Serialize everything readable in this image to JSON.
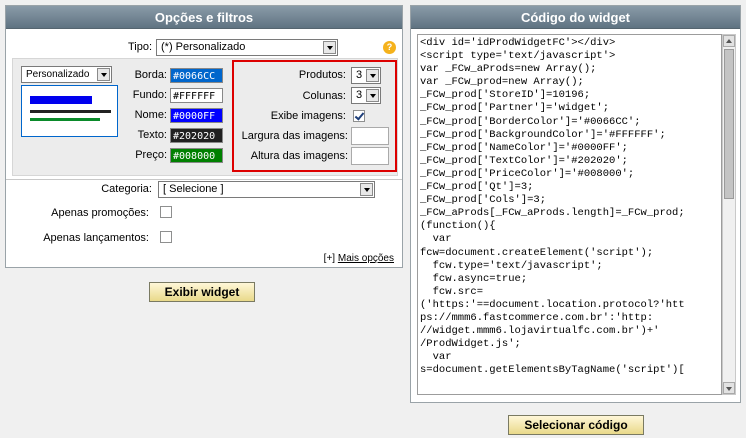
{
  "left_panel": {
    "title": "Opções e filtros",
    "tipo_label": "Tipo:",
    "tipo_value": "(*) Personalizado",
    "help_icon": "?",
    "preset_select": "Personalizado",
    "preview_colors": [
      "#0000ee",
      "#222222",
      "#0a8a2a"
    ],
    "colors": [
      {
        "label": "Borda:",
        "value": "#0066CC",
        "bg": "#0066cc",
        "fg": "#ffffff"
      },
      {
        "label": "Fundo:",
        "value": "#FFFFFF",
        "bg": "#ffffff",
        "fg": "#000000"
      },
      {
        "label": "Nome:",
        "value": "#0000FF",
        "bg": "#0000ff",
        "fg": "#ffffff"
      },
      {
        "label": "Texto:",
        "value": "#202020",
        "bg": "#202020",
        "fg": "#ffffff"
      },
      {
        "label": "Preço:",
        "value": "#008000",
        "bg": "#008000",
        "fg": "#ffffff"
      }
    ],
    "produtos_label": "Produtos:",
    "produtos_value": "3",
    "colunas_label": "Colunas:",
    "colunas_value": "3",
    "exibe_imagens_label": "Exibe imagens:",
    "exibe_imagens_checked": true,
    "largura_label": "Largura das imagens:",
    "altura_label": "Altura das imagens:",
    "categoria_label": "Categoria:",
    "categoria_value": "[ Selecione ]",
    "promocoes_label": "Apenas promoções:",
    "lancamentos_label": "Apenas lançamentos:",
    "mais_opcoes_prefix": "[+]",
    "mais_opcoes_link": "Mais opções"
  },
  "exibir_button": "Exibir widget",
  "right_panel": {
    "title": "Código do widget",
    "code": "<div id='idProdWidgetFC'></div>\n<script type='text/javascript'>\nvar _FCw_aProds=new Array();\nvar _FCw_prod=new Array();\n_FCw_prod['StoreID']=10196;\n_FCw_prod['Partner']='widget';\n_FCw_prod['BorderColor']='#0066CC';\n_FCw_prod['BackgroundColor']='#FFFFFF';\n_FCw_prod['NameColor']='#0000FF';\n_FCw_prod['TextColor']='#202020';\n_FCw_prod['PriceColor']='#008000';\n_FCw_prod['Qt']=3;\n_FCw_prod['Cols']=3;\n_FCw_aProds[_FCw_aProds.length]=_FCw_prod;\n(function(){\n  var\nfcw=document.createElement('script');\n  fcw.type='text/javascript';\n  fcw.async=true;\n  fcw.src=\n('https:'==document.location.protocol?'htt\nps://mmm6.fastcommerce.com.br':'http:\n//widget.mmm6.lojavirtualfc.com.br')+'\n/ProdWidget.js';\n  var\ns=document.getElementsByTagName('script')["
  },
  "selecionar_button": "Selecionar código"
}
